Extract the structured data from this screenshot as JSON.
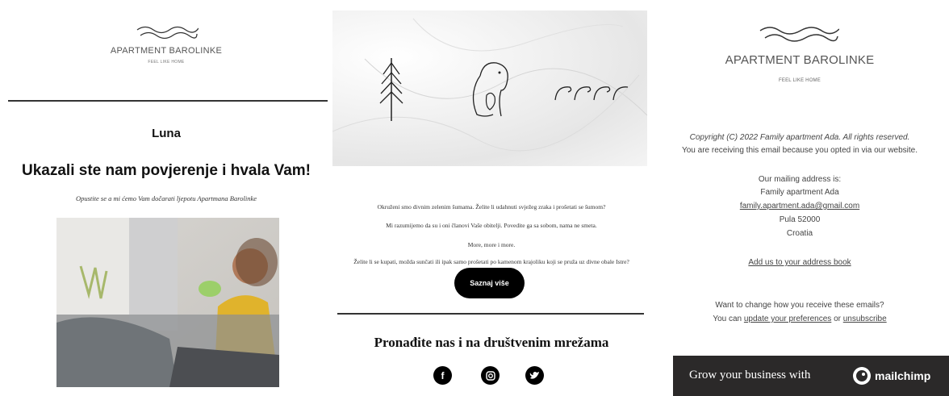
{
  "panel1": {
    "brand": "APARTMENT BAROLINKE",
    "tagline": "FEEL LIKE HOME",
    "name": "Luna",
    "heading": "Ukazali ste nam povjerenje i hvala Vam!",
    "subtitle": "Opustite se a mi ćemo Vam dočarati ljepotu Apartmana Barolinke"
  },
  "panel2": {
    "paragraphs": [
      "Okruženi smo divnim zelenim šumama. Želite li udahnuti svježeg zraka i prošetati se šumom?",
      "Mi razumijemo da su i oni članovi Vaše obitelji. Povedite ga sa sobom, nama ne smeta.",
      "More, more i more.",
      "Želite li se kupati, možda sunčati ili ipak samo prošetati po kamenom krajoliku koji se pruža uz divne obale Istre?"
    ],
    "button_label": "Saznaj više",
    "social_title": "Pronađite nas i na društvenim mrežama",
    "social_icons": [
      "facebook-icon",
      "instagram-icon",
      "twitter-icon"
    ]
  },
  "panel3": {
    "brand": "APARTMENT BAROLINKE",
    "tagline": "FEEL LIKE HOME",
    "copyright": "Copyright (C) 2022 Family apartment Ada. All rights reserved.",
    "opted_in": "You are receiving this email because you opted in via our website.",
    "address_heading": "Our mailing address is:",
    "address_name": "Family apartment Ada",
    "address_email": "family.apartment.ada@gmail.com",
    "address_city": "Pula 52000",
    "address_country": "Croatia",
    "add_book": "Add us to your address book",
    "change_text": "Want to change how you receive these emails?",
    "you_can": "You can",
    "update_prefs": "update your preferences",
    "or": "or",
    "unsubscribe": "unsubscribe",
    "mc_text": "Grow your business with",
    "mc_brand": "mailchimp"
  }
}
